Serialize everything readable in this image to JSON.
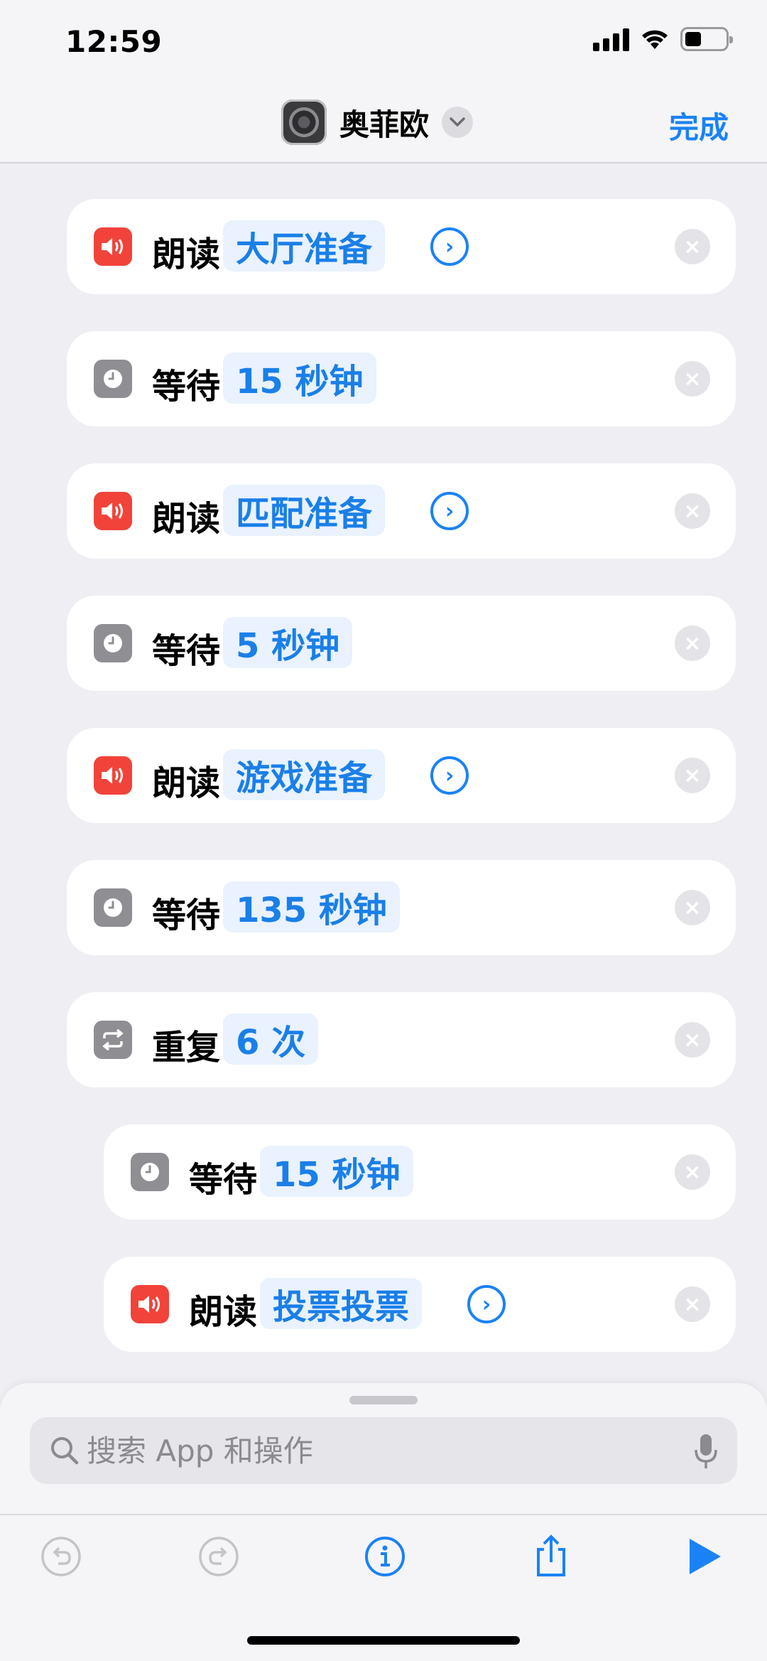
{
  "status_bar": {
    "time": "12:59"
  },
  "nav": {
    "title": "奥菲欧",
    "done_label": "完成"
  },
  "actions": [
    {
      "label": "朗读",
      "param": "大厅准备"
    },
    {
      "label": "等待",
      "param": "15 秒钟"
    },
    {
      "label": "朗读",
      "param": "匹配准备"
    },
    {
      "label": "等待",
      "param": "5 秒钟"
    },
    {
      "label": "朗读",
      "param": "游戏准备"
    },
    {
      "label": "等待",
      "param": "135 秒钟"
    },
    {
      "label": "重复",
      "param": "6 次"
    },
    {
      "label": "等待",
      "param": "15 秒钟"
    },
    {
      "label": "朗读",
      "param": "投票投票"
    }
  ],
  "search": {
    "placeholder": "搜索 App 和操作"
  },
  "icons": {
    "speak": "speaker-icon",
    "wait": "clock-icon",
    "repeat": "repeat-icon",
    "remove": "close-icon",
    "detail": "chevron-right-circle-icon"
  },
  "colors": {
    "accent": "#1a82f5",
    "speak_bg": "#f2433a",
    "wait_bg": "#8e8e93"
  }
}
